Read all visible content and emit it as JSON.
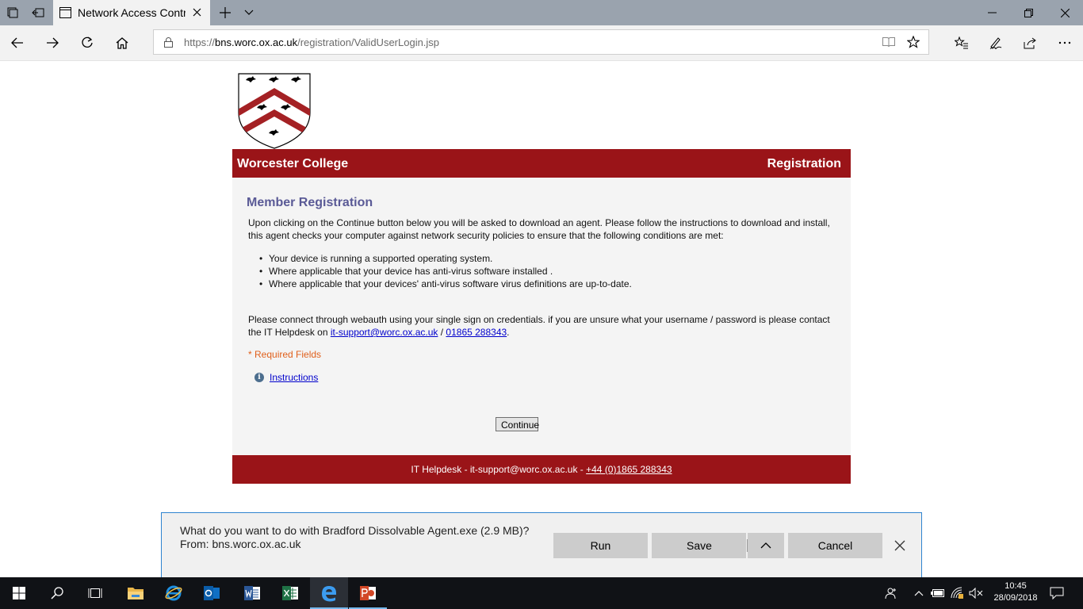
{
  "browser": {
    "tab_title": "Network Access Control",
    "url_prefix": "https://",
    "url_host": "bns.worc.ox.ac.uk",
    "url_path": "/registration/ValidUserLogin.jsp"
  },
  "page": {
    "header_left": "Worcester College",
    "header_right": "Registration",
    "section_title": "Member Registration",
    "intro": "Upon clicking on the Continue button below you will be asked to download an agent. Please follow the instructions to download and install, this agent checks your computer against network security policies to ensure that the following conditions are met:",
    "conditions": [
      "Your device is running a supported operating system.",
      "Where applicable that your device has anti-virus software installed .",
      "Where applicable that your devices' anti-virus software virus definitions are up-to-date."
    ],
    "connect_text": "Please connect through webauth using your single sign on credentials. if you are unsure what your username / password is please contact the IT Helpdesk on ",
    "support_email": "it-support@worc.ox.ac.uk",
    "separator": " / ",
    "support_phone": "01865 288343",
    "period": ".",
    "required_fields": "* Required Fields",
    "instructions_link": "Instructions",
    "continue_button": "Continue",
    "footer_text": "IT Helpdesk - it-support@worc.ox.ac.uk - ",
    "footer_phone": "+44 (0)1865 288343"
  },
  "download_bar": {
    "message": "What do you want to do with Bradford Dissolvable Agent.exe (2.9 MB)?",
    "from": "From: bns.worc.ox.ac.uk",
    "run": "Run",
    "save": "Save",
    "cancel": "Cancel"
  },
  "taskbar": {
    "time": "10:45",
    "date": "28/09/2018"
  },
  "colors": {
    "brand_red": "#9a1418",
    "title_purple": "#5a5a96",
    "required_orange": "#e0601c",
    "link_blue": "#0000cc"
  }
}
